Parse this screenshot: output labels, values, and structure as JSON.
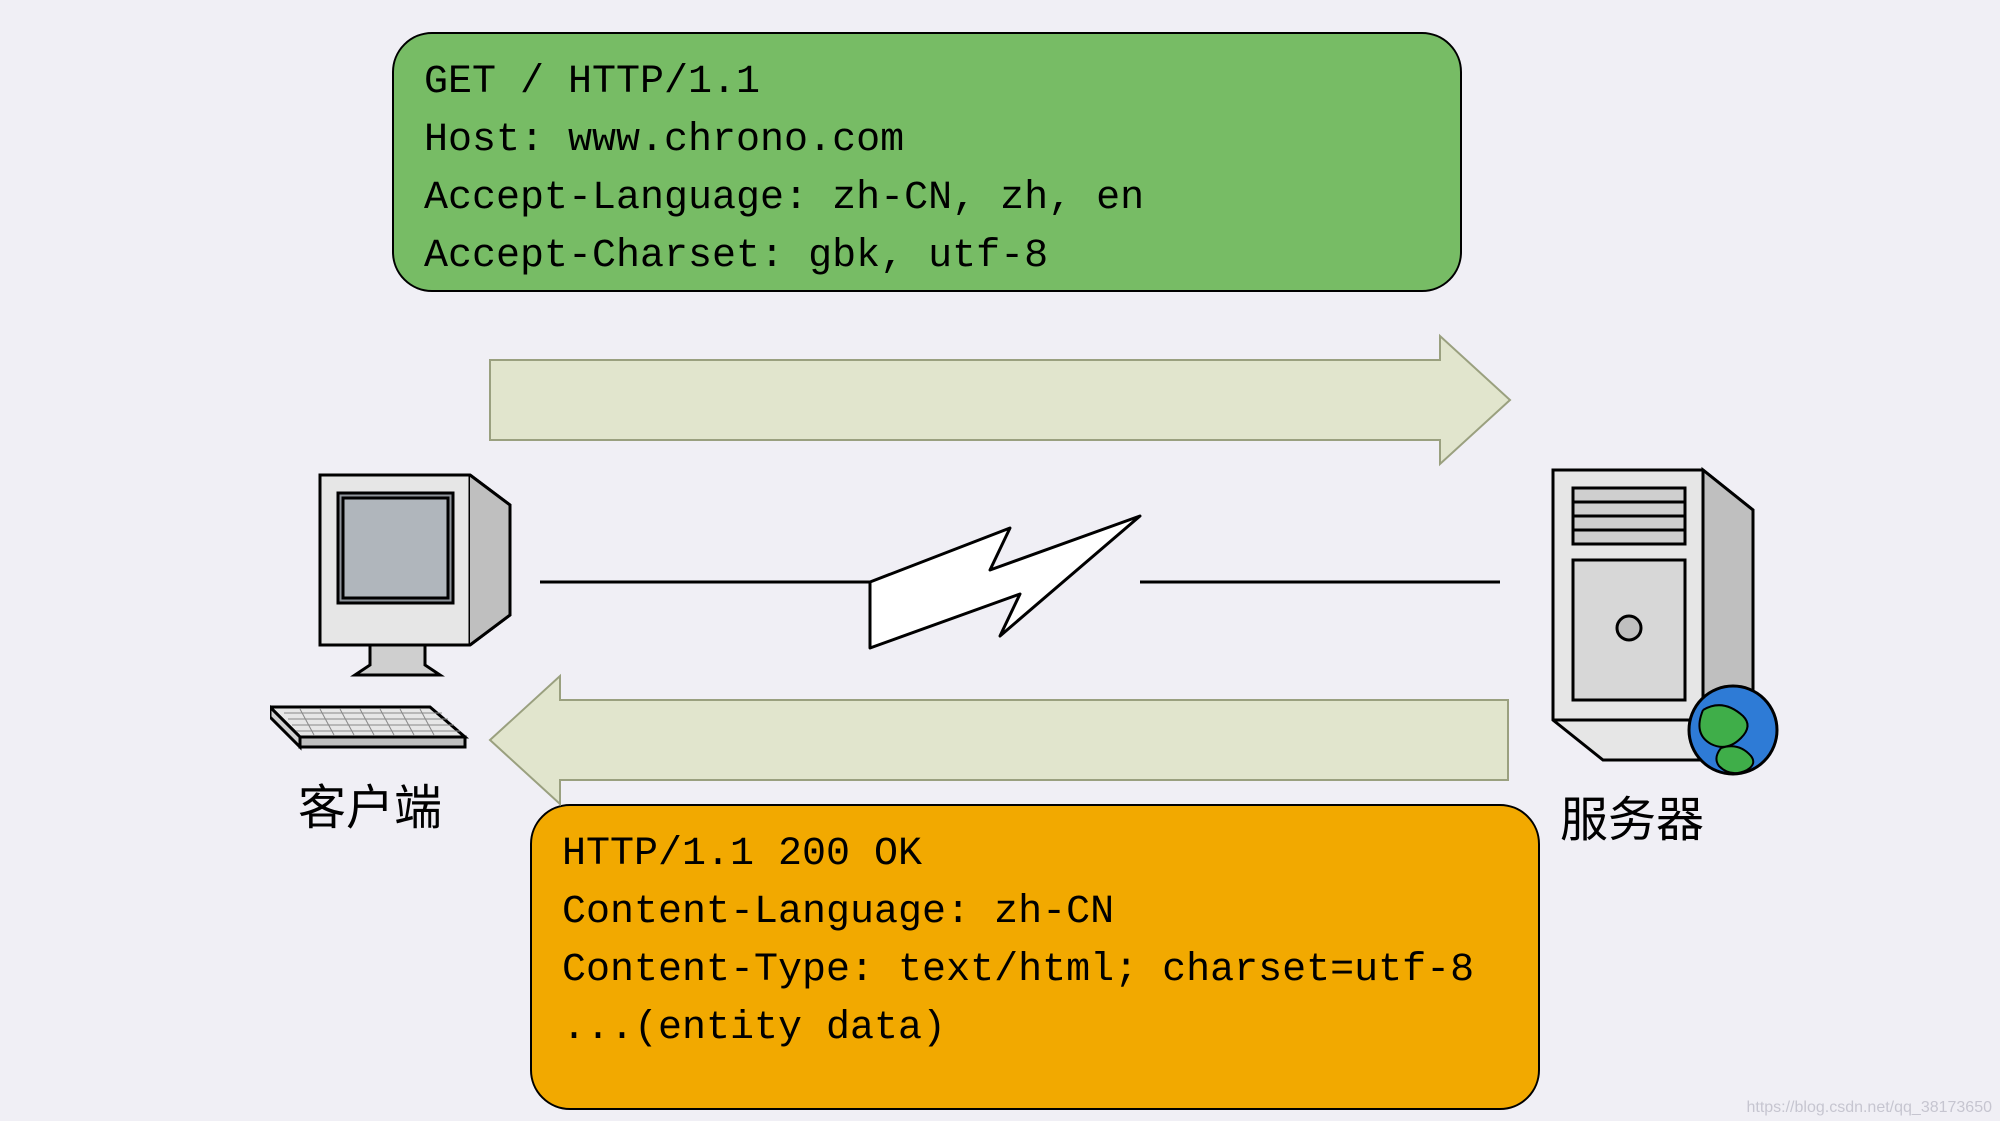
{
  "request": {
    "lines": [
      "GET / HTTP/1.1",
      "Host: www.chrono.com",
      "Accept-Language: zh-CN, zh, en",
      "Accept-Charset: gbk, utf-8"
    ]
  },
  "response": {
    "lines": [
      "HTTP/1.1 200 OK",
      "Content-Language: zh-CN",
      "Content-Type: text/html; charset=utf-8",
      "",
      "...(entity data)"
    ]
  },
  "labels": {
    "client": "客户端",
    "server": "服务器"
  },
  "colors": {
    "request_box": "#77bc65",
    "response_box": "#f2a900",
    "arrow_fill": "#e1e5cd",
    "arrow_stroke": "#9aa07f"
  },
  "watermark": "https://blog.csdn.net/qq_38173650"
}
